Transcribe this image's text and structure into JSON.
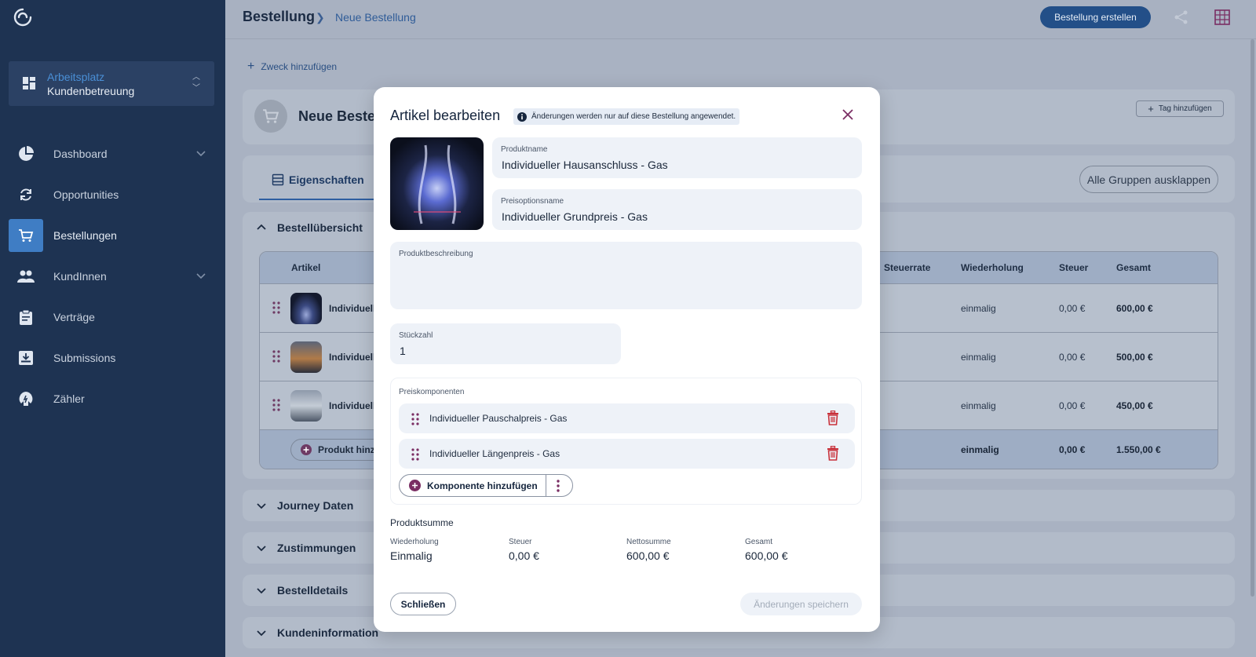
{
  "sidebar": {
    "workspace_label": "Arbeitsplatz",
    "workspace_value": "Kundenbetreuung",
    "items": [
      {
        "label": "Dashboard",
        "icon": "pie-chart-icon"
      },
      {
        "label": "Opportunities",
        "icon": "refresh-icon"
      },
      {
        "label": "Bestellungen",
        "icon": "cart-icon"
      },
      {
        "label": "KundInnen",
        "icon": "people-icon"
      },
      {
        "label": "Verträge",
        "icon": "clipboard-icon"
      },
      {
        "label": "Submissions",
        "icon": "inbox-download-icon"
      },
      {
        "label": "Zähler",
        "icon": "meter-icon"
      }
    ]
  },
  "header": {
    "crumb_root": "Bestellung",
    "crumb_current": "Neue Bestellung",
    "create_button": "Bestellung erstellen"
  },
  "page": {
    "add_purpose": "Zweck hinzufügen",
    "order_title": "Neue Bestellung",
    "add_tag": "Tag hinzufügen",
    "tab_properties": "Eigenschaften",
    "expand_all": "Alle Gruppen ausklappen",
    "sections": {
      "overview": "Bestellübersicht",
      "journey": "Journey Daten",
      "consents": "Zustimmungen",
      "details": "Bestelldetails",
      "customer": "Kundeninformation"
    },
    "table": {
      "headers": {
        "article": "Artikel",
        "tax_rate": "Steuerrate",
        "recurrence": "Wiederholung",
        "tax": "Steuer",
        "total": "Gesamt"
      },
      "rows": [
        {
          "name": "Individuell",
          "recurrence": "einmalig",
          "tax": "0,00 €",
          "total": "600,00 €"
        },
        {
          "name": "Individuell",
          "recurrence": "einmalig",
          "tax": "0,00 €",
          "total": "500,00 €"
        },
        {
          "name": "Individuell",
          "recurrence": "einmalig",
          "tax": "0,00 €",
          "total": "450,00 €"
        }
      ],
      "summary": {
        "add_product": "Produkt hinz",
        "recurrence": "einmalig",
        "tax": "0,00 €",
        "total": "1.550,00 €"
      }
    }
  },
  "modal": {
    "title": "Artikel bearbeiten",
    "info": "Änderungen werden nur auf diese Bestellung angewendet.",
    "product_name_label": "Produktname",
    "product_name": "Individueller Hausanschluss - Gas",
    "price_option_label": "Preisoptionsname",
    "price_option": "Individueller Grundpreis - Gas",
    "description_label": "Produktbeschreibung",
    "description": "",
    "quantity_label": "Stückzahl",
    "quantity": "1",
    "price_components_label": "Preiskomponenten",
    "price_components": [
      {
        "name": "Individueller Pauschalpreis - Gas"
      },
      {
        "name": "Individueller Längenpreis - Gas"
      }
    ],
    "add_component": "Komponente hinzufügen",
    "product_sum_title": "Produktsumme",
    "sum": {
      "recurrence_label": "Wiederholung",
      "recurrence": "Einmalig",
      "tax_label": "Steuer",
      "tax": "0,00 €",
      "net_label": "Nettosumme",
      "net": "600,00 €",
      "total_label": "Gesamt",
      "total": "600,00 €"
    },
    "close_button": "Schließen",
    "save_button": "Änderungen speichern"
  },
  "colors": {
    "sidebar": "#1e3352",
    "accent": "#234f88",
    "active_nav": "#3f7dc4",
    "danger": "#c8313a",
    "component_purple": "#7a2e63"
  }
}
